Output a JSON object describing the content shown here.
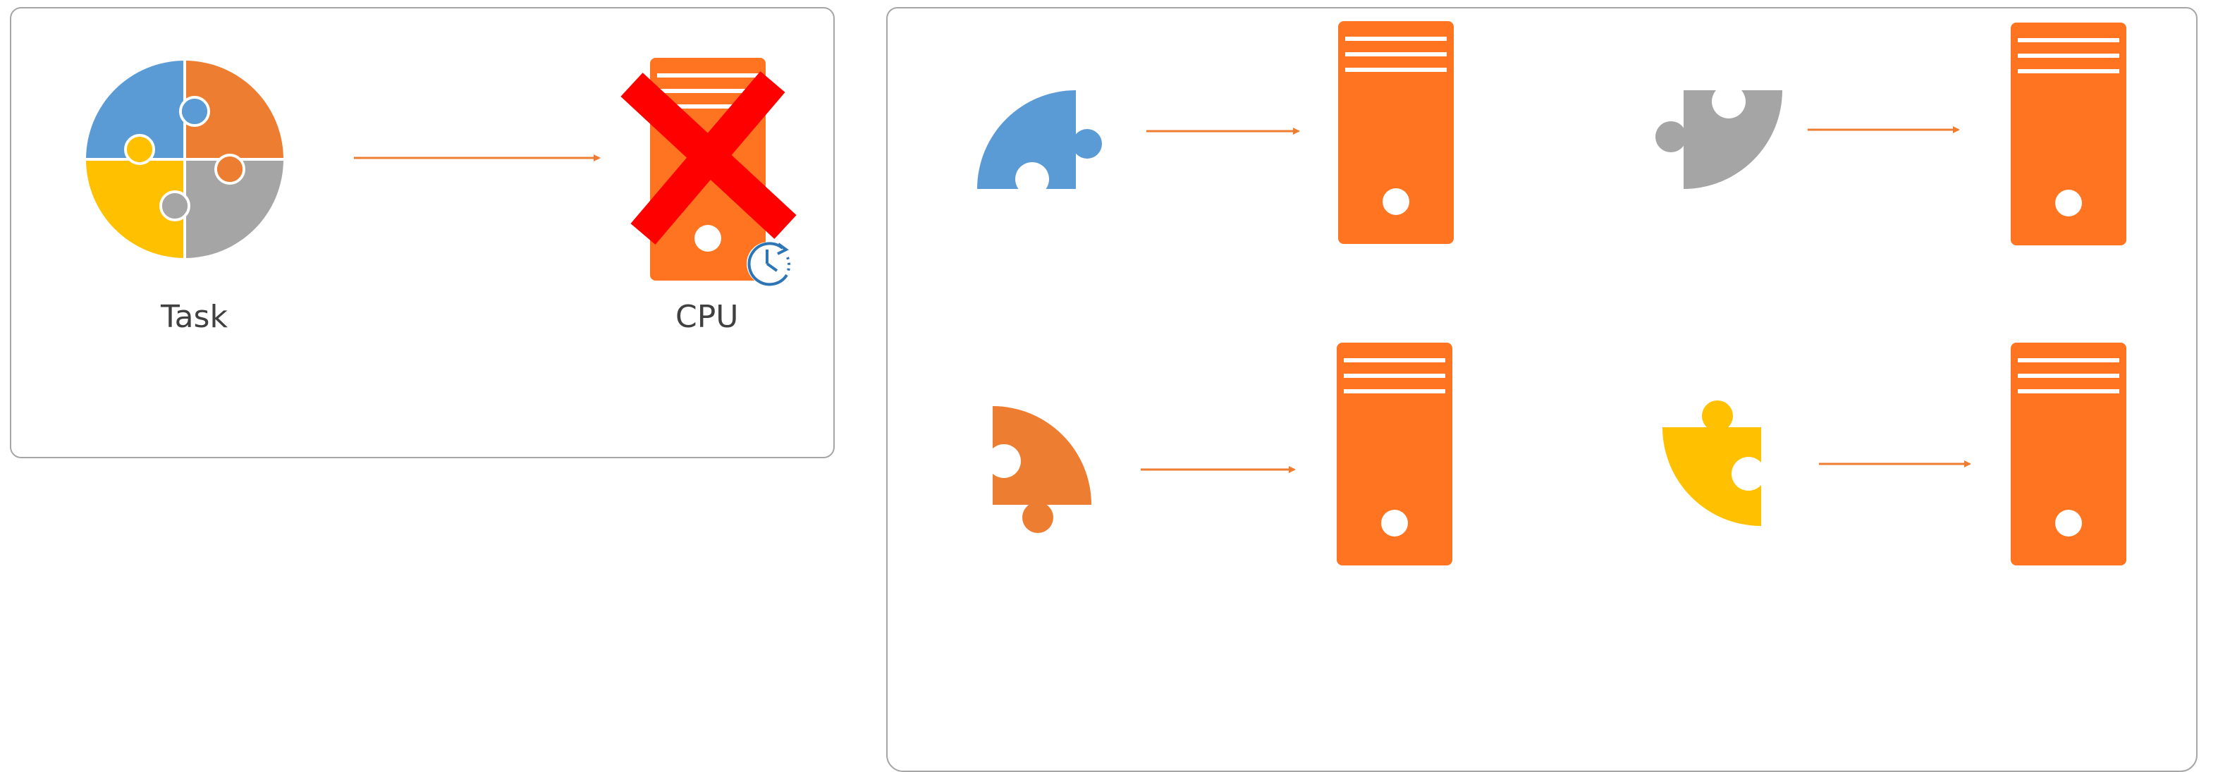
{
  "labels": {
    "task": "Task",
    "cpu": "CPU"
  },
  "colors": {
    "blue": "#5b9bd5",
    "orange_piece": "#ed7d31",
    "yellow": "#ffc000",
    "gray": "#a5a5a5",
    "cpu_orange": "#ff7420",
    "red_x": "#ff0000",
    "panel_border": "#a6a6a6",
    "clock": "#2e75b6"
  },
  "icons": {
    "task": "puzzle-circle-icon",
    "cpu": "server-tower-icon",
    "failure": "red-x-icon",
    "wait": "clock-icon"
  }
}
